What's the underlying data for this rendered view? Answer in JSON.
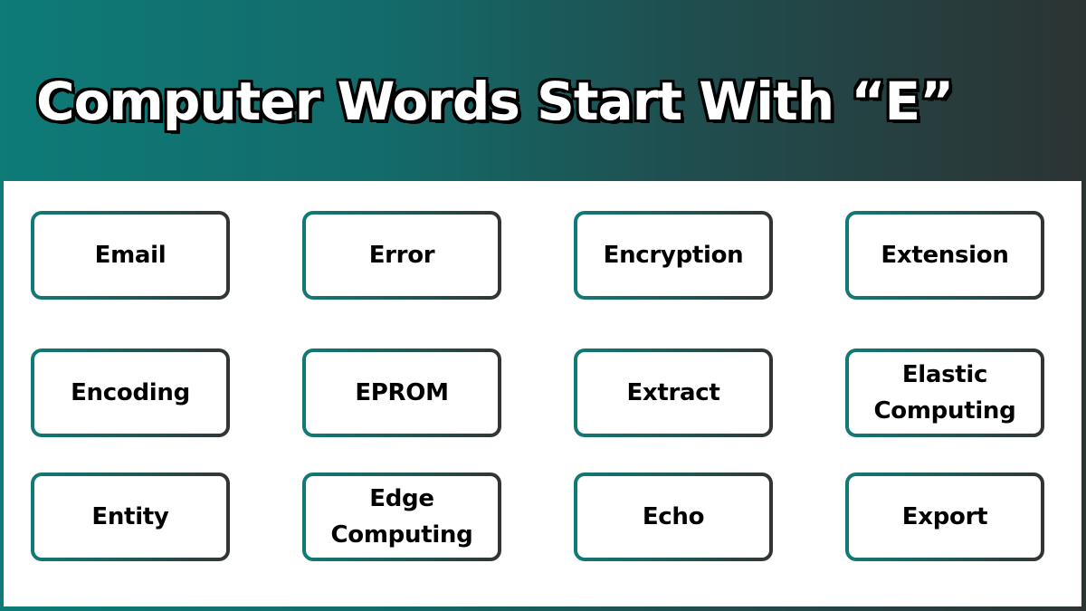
{
  "header": {
    "title": "Computer Words Start With “E”"
  },
  "colors": {
    "gradient_start": "#0e7b78",
    "gradient_end": "#2c3333",
    "card_border_start": "#117a76",
    "card_border_end": "#333333",
    "card_background": "#ffffff",
    "text": "#000000"
  },
  "words": [
    {
      "label": "Email"
    },
    {
      "label": "Error"
    },
    {
      "label": "Encryption"
    },
    {
      "label": "Extension"
    },
    {
      "label": "Encoding"
    },
    {
      "label": "EPROM"
    },
    {
      "label": "Extract"
    },
    {
      "label": "Elastic\nComputing"
    },
    {
      "label": "Entity"
    },
    {
      "label": "Edge\nComputing"
    },
    {
      "label": "Echo"
    },
    {
      "label": "Export"
    }
  ]
}
